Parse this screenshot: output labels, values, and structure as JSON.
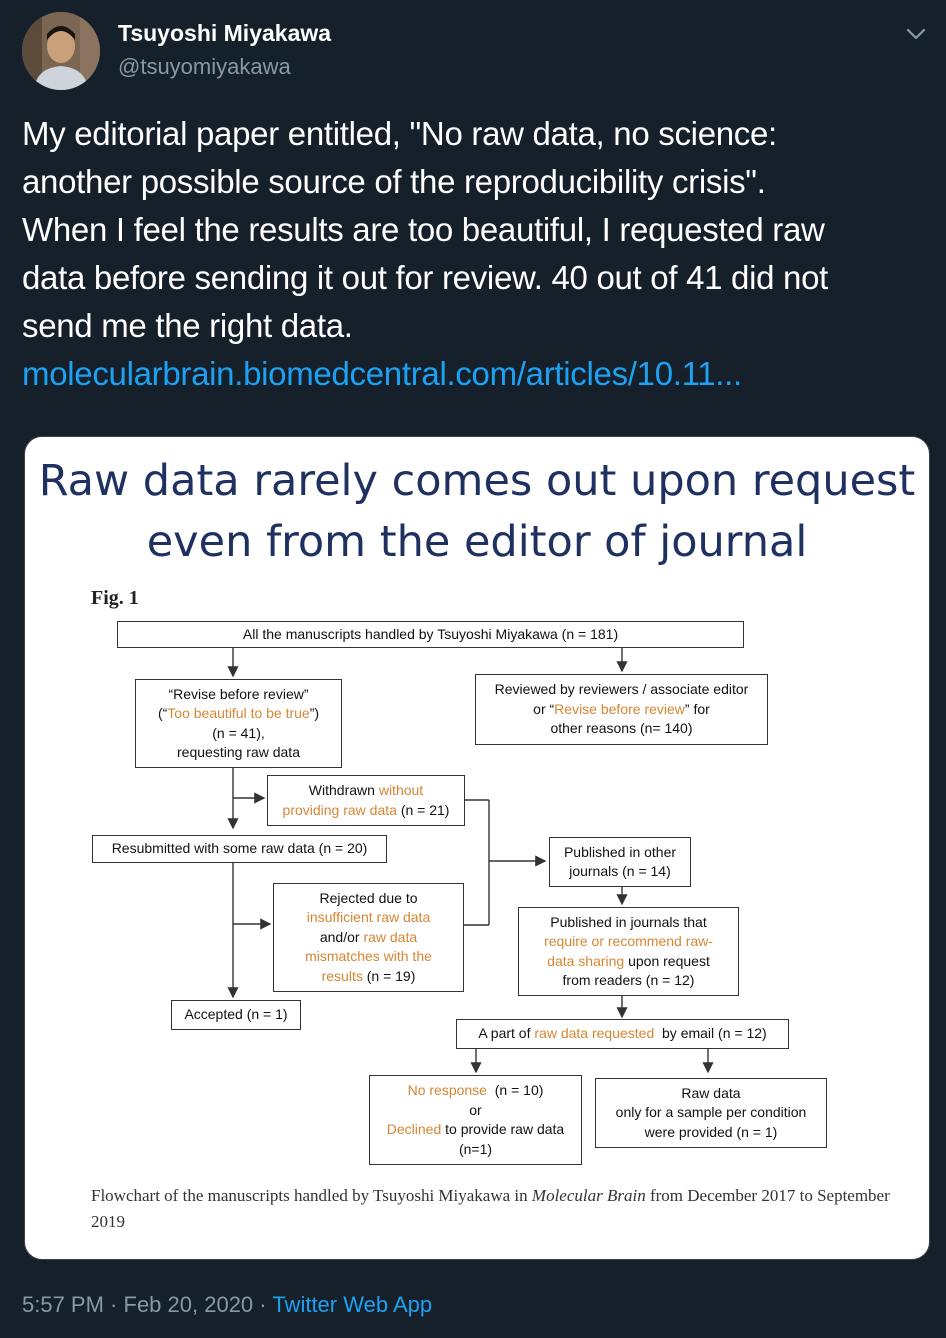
{
  "author": {
    "name": "Tsuyoshi Miyakawa",
    "handle": "@tsuyomiyakawa"
  },
  "tweet": {
    "text_lines": [
      "My editorial paper entitled, \"No raw data, no science:",
      "another possible source of the reproducibility crisis\".",
      "When I feel the results are too beautiful, I requested raw",
      "data before sending it out for review. 40 out of 41 did not",
      "send me the right data."
    ],
    "link": "molecularbrain.biomedcentral.com/articles/10.11..."
  },
  "image": {
    "title_line1": "Raw data rarely comes out upon request",
    "title_line2": "even from the editor of journal",
    "fig_label": "Fig. 1",
    "caption_pre": "Flowchart of the manuscripts handled by Tsuyoshi Miyakawa in ",
    "caption_journal": "Molecular Brain",
    "caption_post": " from December 2017 to September 2019",
    "boxes": {
      "all": "All the manuscripts handled by Tsuyoshi Miyakawa (n = 181)",
      "rbr_l1": "“Revise before review”",
      "rbr_l2a": "(“",
      "rbr_l2b": "Too beautiful to be true",
      "rbr_l2c": "”)",
      "rbr_l3": "(n = 41),",
      "rbr_l4": "requesting raw data",
      "rev_l1": "Reviewed by reviewers / associate editor",
      "rev_l2a": "or “",
      "rev_l2b": "Revise before review",
      "rev_l2c": "” for",
      "rev_l3": "other reasons (n= 140)",
      "wd_l1a": "Withdrawn ",
      "wd_l1b": "without",
      "wd_l2a": "providing raw data",
      "wd_l2b": " (n = 21)",
      "resub": "Resubmitted with some raw data (n = 20)",
      "pub_other_l1": "Published in other",
      "pub_other_l2": "journals (n = 14)",
      "rej_l1": "Rejected due to",
      "rej_l2": "insufficient raw data",
      "rej_l3a": "and/or ",
      "rej_l3b": "raw data",
      "rej_l4": "mismatches with the",
      "rej_l5a": "results",
      "rej_l5b": " (n = 19)",
      "pubj_l1": "Published in journals that",
      "pubj_l2": "require or recommend raw-",
      "pubj_l3a": "data sharing",
      "pubj_l3b": "  upon request",
      "pubj_l4": "from readers (n = 12)",
      "acc": "Accepted (n = 1)",
      "part_a": "A part of ",
      "part_b": "raw data requested",
      "part_c": "  by email (n = 12)",
      "nr_l1a": "No response",
      "nr_l1b": "  (n = 10)",
      "nr_l2": "or",
      "nr_l3a": "Declined",
      "nr_l3b": " to provide raw data",
      "nr_l4": "(n=1)",
      "raw_l1": "Raw data",
      "raw_l2": "only for a sample per condition",
      "raw_l3": "were provided (n = 1)"
    },
    "colors": {
      "title": "#1f3160",
      "highlight": "#d68633"
    }
  },
  "meta": {
    "time": "5:57 PM",
    "sep1": " · ",
    "date": "Feb 20, 2020",
    "sep2": " · ",
    "app": "Twitter Web App"
  }
}
